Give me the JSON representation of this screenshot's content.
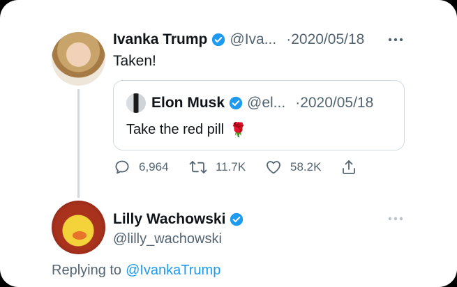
{
  "tweet": {
    "author_name": "Ivanka Trump",
    "handle": "@Iva...",
    "date": "2020/05/18",
    "separator": "·",
    "text": "Taken!",
    "more_glyph": "···"
  },
  "quote": {
    "author_name": "Elon Musk",
    "handle": "@el...",
    "date": "2020/05/18",
    "separator": "·",
    "text": "Take the red pill",
    "emoji": "🌹"
  },
  "actions": {
    "reply_count": "6,964",
    "retweet_count": "11.7K",
    "like_count": "58.2K"
  },
  "reply": {
    "author_name": "Lilly Wachowski",
    "handle": "@lilly_wachowski",
    "replying_prefix": "Replying to",
    "replying_handle": "@IvankaTrump"
  },
  "colors": {
    "accent": "#1d9bf0",
    "secondary_text": "#536471",
    "border": "#cfd9de"
  },
  "icons": [
    "verified-badge-icon",
    "more-icon",
    "reply-icon",
    "retweet-icon",
    "like-icon",
    "share-icon"
  ]
}
